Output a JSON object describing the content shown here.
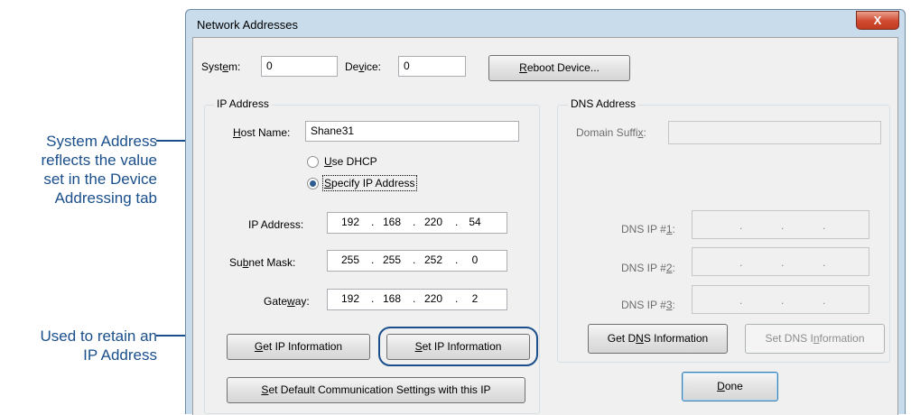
{
  "callouts": {
    "system_address": [
      "System Address",
      "reflects the value",
      "set in the Device",
      "Addressing tab"
    ],
    "retain_ip": [
      "Used to retain an",
      "IP Address"
    ]
  },
  "window": {
    "title": "Network Addresses",
    "close_glyph": "X"
  },
  "top": {
    "system_label": "System:",
    "system_value": "0",
    "device_label": "Device:",
    "device_value": "0",
    "reboot_label": "Reboot Device..."
  },
  "ip_group": {
    "title": "IP Address",
    "host_label": "Host Name:",
    "host_value": "Shane31",
    "use_dhcp": "Use DHCP",
    "specify_ip": "Specify IP Address",
    "selected": "Specify IP Address",
    "ip_label": "IP Address:",
    "ip": [
      "192",
      "168",
      "220",
      "54"
    ],
    "subnet_label": "Subnet Mask:",
    "subnet": [
      "255",
      "255",
      "252",
      "0"
    ],
    "gateway_label": "Gateway:",
    "gateway": [
      "192",
      "168",
      "220",
      "2"
    ],
    "get_ip_button": "Get IP Information",
    "set_ip_button": "Set IP Information",
    "set_default_button": "Set Default Communication Settings with this IP"
  },
  "dns_group": {
    "title": "DNS Address",
    "domain_suffix_label": "Domain Suffix:",
    "domain_suffix_value": "",
    "dns1_label": "DNS IP #1:",
    "dns2_label": "DNS IP #2:",
    "dns3_label": "DNS IP #3:",
    "get_dns_button": "Get DNS Information",
    "set_dns_button": "Set DNS Information"
  },
  "done_button": "Done",
  "colors": {
    "callout": "#1a4f8b",
    "window_frame": "#c9dcec",
    "close_button": "#c23c22"
  }
}
